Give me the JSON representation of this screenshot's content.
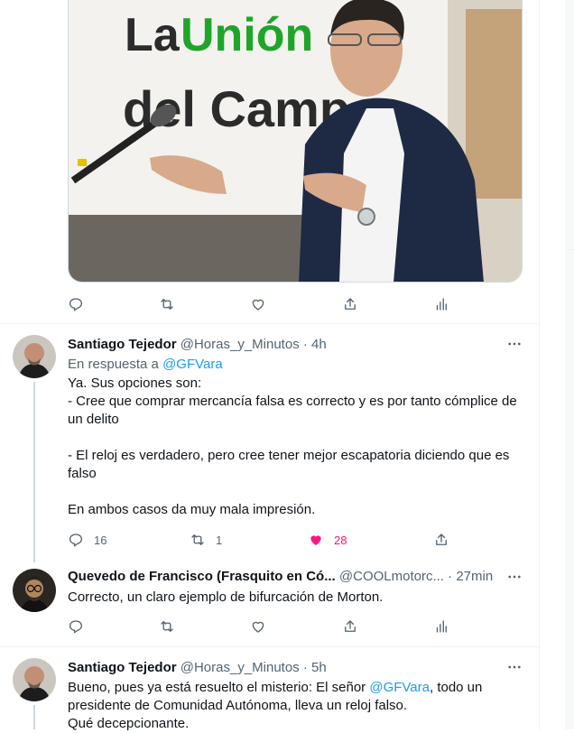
{
  "image_post": {
    "photo_text_line1_a": "La ",
    "photo_text_line1_b": "Unión",
    "photo_text_line2": "del Campo",
    "actions": {
      "reply": "",
      "retweet": "",
      "like": ""
    }
  },
  "tweets": [
    {
      "name": "Santiago Tejedor",
      "handle": "@Horas_y_Minutos",
      "dot": "·",
      "time": "4h",
      "reply_prefix": "En respuesta a ",
      "reply_handle": "@GFVara",
      "lines": [
        "Ya. Sus opciones son:",
        "- Cree que comprar mercancía falsa es correcto y es por tanto cómplice de un delito",
        "",
        "- El reloj es verdadero, pero cree tener mejor escapatoria diciendo que es falso",
        "",
        "En ambos casos da muy mala impresión."
      ],
      "replies": "16",
      "retweets": "1",
      "likes": "28"
    },
    {
      "name": "Quevedo de Francisco (Frasquito en Có...",
      "handle": "@COOLmotorc...",
      "dot": "·",
      "time": "27min",
      "text": "Correcto, un claro ejemplo de bifurcación de Morton."
    },
    {
      "name": "Santiago Tejedor",
      "handle": "@Horas_y_Minutos",
      "dot": "·",
      "time": "5h",
      "text_a": "Bueno, pues ya está resuelto el misterio: El señor ",
      "text_mention": "@GFVara",
      "text_b": ", todo un presidente de Comunidad Autónoma, lleva un reloj falso.",
      "text_line3": "Qué decepcionante."
    }
  ],
  "colors": {
    "accent": "#1d9bf0",
    "like": "#f91880",
    "muted": "#536471"
  },
  "icons": [
    "reply-icon",
    "retweet-icon",
    "like-icon",
    "share-icon",
    "analytics-icon",
    "more-icon"
  ]
}
